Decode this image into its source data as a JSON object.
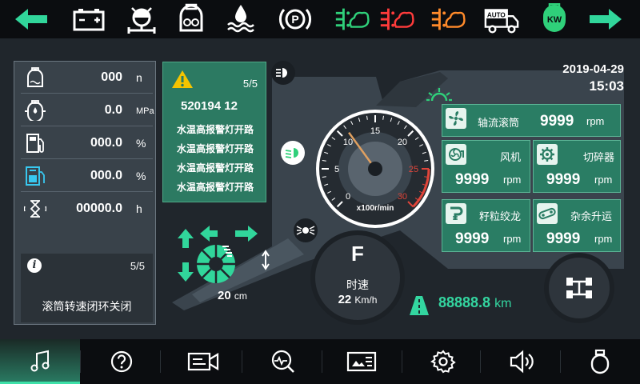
{
  "top_indicators": [
    {
      "name": "left-turn-icon",
      "color": "#31d69b"
    },
    {
      "name": "battery-icon",
      "color": "#ffffff"
    },
    {
      "name": "steering-axle-icon",
      "color": "#ffffff"
    },
    {
      "name": "engine-oil-icon",
      "color": "#ffffff"
    },
    {
      "name": "coolant-temp-icon",
      "color": "#ffffff"
    },
    {
      "name": "parking-brake-icon",
      "color": "#ffffff"
    },
    {
      "name": "grain-tank-green-icon",
      "color": "#2fd07a"
    },
    {
      "name": "grain-tank-red-icon",
      "color": "#ff3b3b"
    },
    {
      "name": "grain-tank-orange-icon",
      "color": "#ff8a2a"
    },
    {
      "name": "auto-mode-icon",
      "color": "#ffffff",
      "label": "AUTO"
    },
    {
      "name": "kw-power-icon",
      "color": "#2fd07a",
      "label": "KW"
    },
    {
      "name": "right-turn-icon",
      "color": "#31d69b"
    }
  ],
  "stats": [
    {
      "icon": "engine-oil-level-icon",
      "value": "000",
      "unit": "n"
    },
    {
      "icon": "oil-pressure-icon",
      "value": "0.0",
      "unit": "MPa"
    },
    {
      "icon": "fuel-level-icon",
      "value": "000.0",
      "unit": "%"
    },
    {
      "icon": "adblue-icon",
      "value": "000.0",
      "unit": "%"
    },
    {
      "icon": "hour-meter-icon",
      "value": "00000.0",
      "unit": "h"
    }
  ],
  "notice": {
    "page": "5/5",
    "message": "滚筒转速闭环关闭"
  },
  "alarm": {
    "page": "5/5",
    "code": "520194 12",
    "lines": [
      "水温高报警灯开路",
      "水温高报警灯开路",
      "水温高报警灯开路",
      "水温高报警灯开路"
    ]
  },
  "datetime": {
    "date": "2019-04-29",
    "time": "15:03"
  },
  "gauge": {
    "ticks": [
      "0",
      "5",
      "10",
      "15",
      "20",
      "25",
      "30"
    ],
    "unit": "x100r/min",
    "value": 11,
    "max": 30,
    "red_from": 25
  },
  "cards": [
    {
      "id": "axial-drum",
      "icon": "fan-icon",
      "name": "轴流滚筒",
      "value": "9999",
      "unit": "rpm"
    },
    {
      "id": "fan",
      "icon": "blower-icon",
      "name": "风机",
      "value": "9999",
      "unit": "rpm"
    },
    {
      "id": "chopper",
      "icon": "chopper-gear-icon",
      "name": "切碎器",
      "value": "9999",
      "unit": "rpm"
    },
    {
      "id": "grain-auger",
      "icon": "auger-icon",
      "name": "籽粒绞龙",
      "value": "9999",
      "unit": "rpm"
    },
    {
      "id": "tailings-elevator",
      "icon": "chain-icon",
      "name": "杂余升运",
      "value": "9999",
      "unit": "rpm"
    }
  ],
  "header": {
    "height": "20",
    "height_unit": "cm"
  },
  "speed": {
    "gear": "F",
    "label": "时速",
    "value": "22",
    "unit": "Km/h"
  },
  "odometer": {
    "value": "88888.8",
    "unit": "km"
  },
  "bottom_nav": [
    {
      "name": "music-button",
      "icon": "music-note-icon",
      "active": true
    },
    {
      "name": "help-button",
      "icon": "question-icon",
      "active": false
    },
    {
      "name": "camera-button",
      "icon": "video-camera-icon",
      "active": false
    },
    {
      "name": "diagnostics-button",
      "icon": "diagnostics-icon",
      "active": false
    },
    {
      "name": "info-card-button",
      "icon": "info-card-icon",
      "active": false
    },
    {
      "name": "settings-button",
      "icon": "gear-icon",
      "active": false
    },
    {
      "name": "volume-button",
      "icon": "speaker-icon",
      "active": false
    },
    {
      "name": "power-button",
      "icon": "power-icon",
      "active": false
    }
  ],
  "colors": {
    "accent": "#2a7d64",
    "accent_bright": "#33d6a0",
    "panel": "#39424a",
    "danger": "#e0453a"
  }
}
